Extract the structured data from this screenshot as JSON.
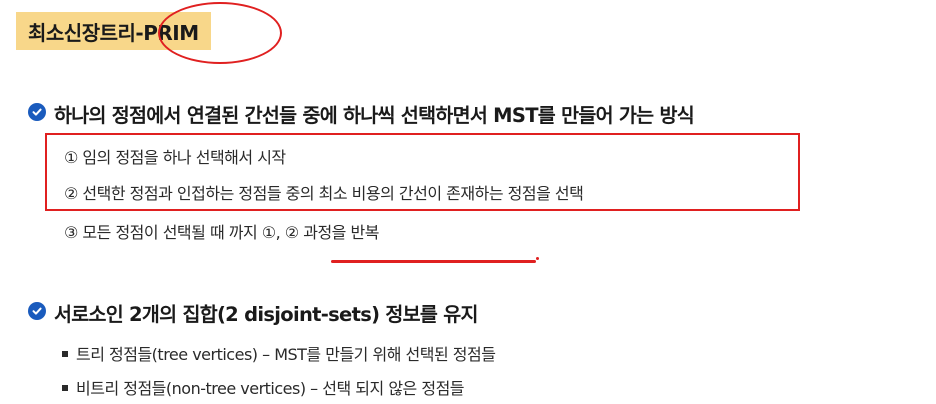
{
  "title": {
    "text": "최소신장트리-PRIM"
  },
  "section1": {
    "heading": "하나의 정점에서 연결된 간선들 중에 하나씩 선택하면서 MST를 만들어 가는 방식",
    "steps": [
      "① 임의 정점을 하나 선택해서 시작",
      "② 선택한 정점과 인접하는 정점들 중의 최소 비용의 간선이 존재하는 정점을 선택",
      "③ 모든 정점이 선택될 때 까지 ①, ② 과정을 반복"
    ]
  },
  "section2": {
    "heading": "서로소인 2개의 집합(2 disjoint-sets) 정보를 유지",
    "items": [
      "트리 정점들(tree vertices) – MST를 만들기 위해 선택된 정점들",
      "비트리 정점들(non-tree vertices) – 선택 되지 않은 정점들"
    ]
  },
  "colors": {
    "title_bg": "#f8d78a",
    "annotation_red": "#e02020",
    "bullet_blue": "#1a5bbd"
  },
  "icons": {
    "section_bullet": "check-circle-icon",
    "sub_bullet": "square-bullet-icon"
  }
}
